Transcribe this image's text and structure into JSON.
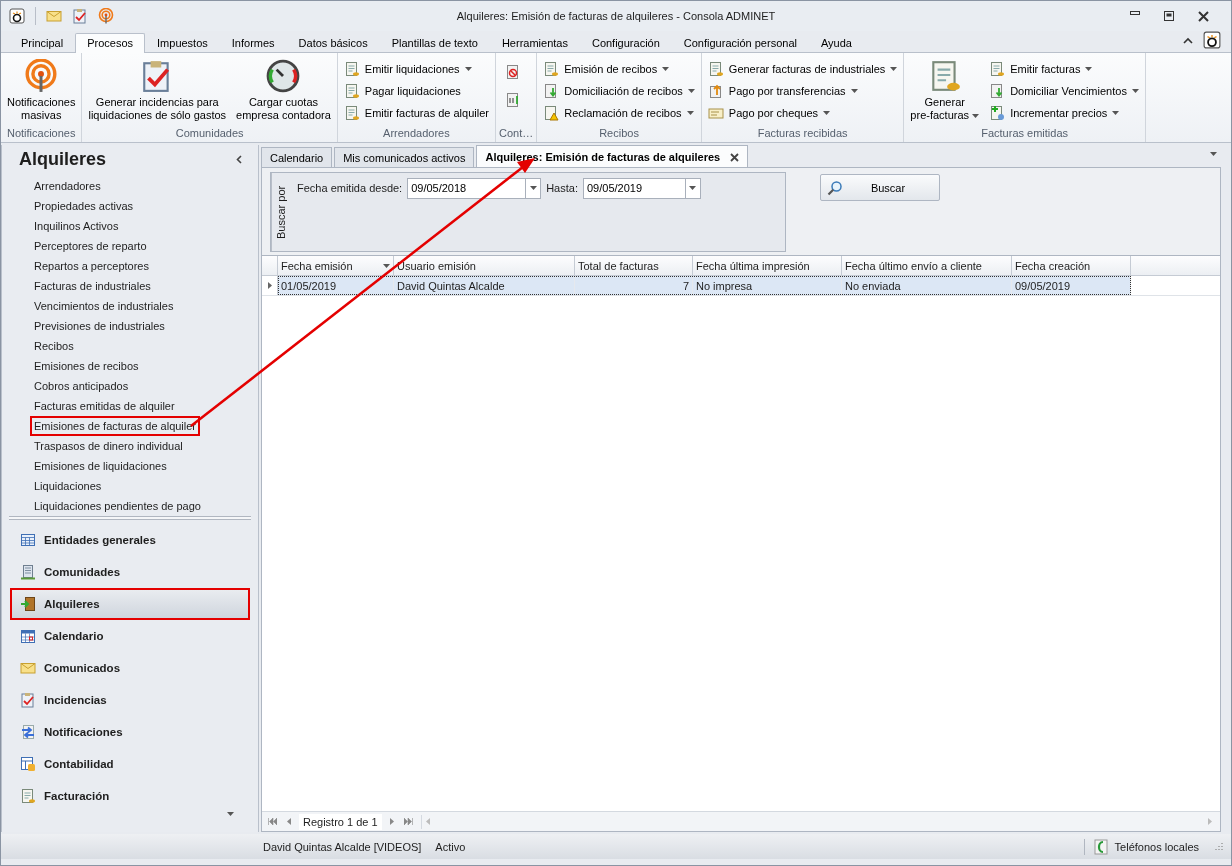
{
  "window": {
    "title": "Alquileres: Emisión de facturas de alquileres - Consola ADMINET"
  },
  "ribbon": {
    "tabs": [
      {
        "label": "Principal",
        "selected": false
      },
      {
        "label": "Procesos",
        "selected": true
      },
      {
        "label": "Impuestos",
        "selected": false
      },
      {
        "label": "Informes",
        "selected": false
      },
      {
        "label": "Datos básicos",
        "selected": false
      },
      {
        "label": "Plantillas de texto",
        "selected": false
      },
      {
        "label": "Herramientas",
        "selected": false
      },
      {
        "label": "Configuración",
        "selected": false
      },
      {
        "label": "Configuración personal",
        "selected": false
      },
      {
        "label": "Ayuda",
        "selected": false
      }
    ],
    "groups": [
      {
        "label": "Notificaciones",
        "items": [
          {
            "kind": "large",
            "label": "Notificaciones\nmasivas",
            "dropdown": false
          }
        ]
      },
      {
        "label": "Comunidades",
        "items": [
          {
            "kind": "large",
            "label": "Generar incidencias para\nliquidaciones de sólo gastos",
            "dropdown": false
          },
          {
            "kind": "large",
            "label": "Cargar cuotas\nempresa contadora",
            "dropdown": false
          }
        ]
      },
      {
        "label": "Arrendadores",
        "items": [
          {
            "kind": "small",
            "label": "Emitir liquidaciones",
            "dropdown": true
          },
          {
            "kind": "small",
            "label": "Pagar liquidaciones",
            "dropdown": false
          },
          {
            "kind": "small",
            "label": "Emitir facturas de alquiler",
            "dropdown": false
          }
        ]
      },
      {
        "label": "Cont…",
        "items": [
          {
            "kind": "icon",
            "dropdown": false
          },
          {
            "kind": "icon",
            "dropdown": false
          }
        ]
      },
      {
        "label": "Recibos",
        "items": [
          {
            "kind": "small",
            "label": "Emisión de recibos",
            "dropdown": true
          },
          {
            "kind": "small",
            "label": "Domiciliación de recibos",
            "dropdown": true
          },
          {
            "kind": "small",
            "label": "Reclamación de recibos",
            "dropdown": true
          }
        ]
      },
      {
        "label": "Facturas recibidas",
        "items": [
          {
            "kind": "small",
            "label": "Generar facturas de industriales",
            "dropdown": true
          },
          {
            "kind": "small",
            "label": "Pago por transferencias",
            "dropdown": true
          },
          {
            "kind": "small",
            "label": "Pago por cheques",
            "dropdown": true
          }
        ]
      },
      {
        "label": "Facturas emitidas",
        "items": [
          {
            "kind": "large",
            "label": "Generar\npre-facturas",
            "dropdown": true
          },
          {
            "kind": "small",
            "label": "Emitir facturas",
            "dropdown": true
          },
          {
            "kind": "small",
            "label": "Domiciliar Vencimientos",
            "dropdown": true
          },
          {
            "kind": "small",
            "label": "Incrementar precios",
            "dropdown": true
          }
        ]
      }
    ]
  },
  "sidebar": {
    "title": "Alquileres",
    "items": [
      {
        "label": "Arrendadores",
        "annotated": false
      },
      {
        "label": "Propiedades activas",
        "annotated": false
      },
      {
        "label": "Inquilinos Activos",
        "annotated": false
      },
      {
        "label": "Perceptores de reparto",
        "annotated": false
      },
      {
        "label": "Repartos a perceptores",
        "annotated": false
      },
      {
        "label": "Facturas de industriales",
        "annotated": false
      },
      {
        "label": "Vencimientos de industriales",
        "annotated": false
      },
      {
        "label": "Previsiones de industriales",
        "annotated": false
      },
      {
        "label": "Recibos",
        "annotated": false
      },
      {
        "label": "Emisiones de recibos",
        "annotated": false
      },
      {
        "label": "Cobros anticipados",
        "annotated": false
      },
      {
        "label": "Facturas emitidas de alquiler",
        "annotated": false
      },
      {
        "label": "Emisiones de facturas de alquiler",
        "annotated": true
      },
      {
        "label": "Traspasos de dinero individual",
        "annotated": false
      },
      {
        "label": "Emisiones de liquidaciones",
        "annotated": false
      },
      {
        "label": "Liquidaciones",
        "annotated": false
      },
      {
        "label": "Liquidaciones pendientes de pago",
        "annotated": false
      }
    ],
    "nav": [
      {
        "label": "Entidades generales",
        "selected": false,
        "annotated": false
      },
      {
        "label": "Comunidades",
        "selected": false,
        "annotated": false
      },
      {
        "label": "Alquileres",
        "selected": true,
        "annotated": true
      },
      {
        "label": "Calendario",
        "selected": false,
        "annotated": false
      },
      {
        "label": "Comunicados",
        "selected": false,
        "annotated": false
      },
      {
        "label": "Incidencias",
        "selected": false,
        "annotated": false
      },
      {
        "label": "Notificaciones",
        "selected": false,
        "annotated": false
      },
      {
        "label": "Contabilidad",
        "selected": false,
        "annotated": false
      },
      {
        "label": "Facturación",
        "selected": false,
        "annotated": false
      }
    ]
  },
  "doc_tabs": [
    {
      "label": "Calendario",
      "selected": false,
      "closable": false
    },
    {
      "label": "Mis comunicados activos",
      "selected": false,
      "closable": false
    },
    {
      "label": "Alquileres: Emisión de facturas de alquileres",
      "selected": true,
      "closable": true
    }
  ],
  "filter": {
    "group_label": "Buscar por",
    "from_label": "Fecha emitida desde:",
    "from_value": "09/05/2018",
    "to_label": "Hasta:",
    "to_value": "09/05/2019",
    "search_button": "Buscar"
  },
  "grid": {
    "columns": [
      {
        "label": "Fecha emisión",
        "sorted": true,
        "kind": "text"
      },
      {
        "label": "Usuario emisión",
        "sorted": false,
        "kind": "text"
      },
      {
        "label": "Total de facturas",
        "sorted": false,
        "kind": "number"
      },
      {
        "label": "Fecha última impresión",
        "sorted": false,
        "kind": "text"
      },
      {
        "label": "Fecha último envío a cliente",
        "sorted": false,
        "kind": "text"
      },
      {
        "label": "Fecha creación",
        "sorted": false,
        "kind": "text"
      }
    ],
    "rows": [
      {
        "selected": true,
        "cells": [
          "01/05/2019",
          "David Quintas Alcalde",
          "7",
          "No impresa",
          "No enviada",
          "09/05/2019"
        ]
      }
    ],
    "pager": "Registro 1 de 1"
  },
  "status_bar": {
    "user": "David Quintas Alcalde [VIDEOS]",
    "state": "Activo",
    "phones": "Teléfonos locales"
  }
}
